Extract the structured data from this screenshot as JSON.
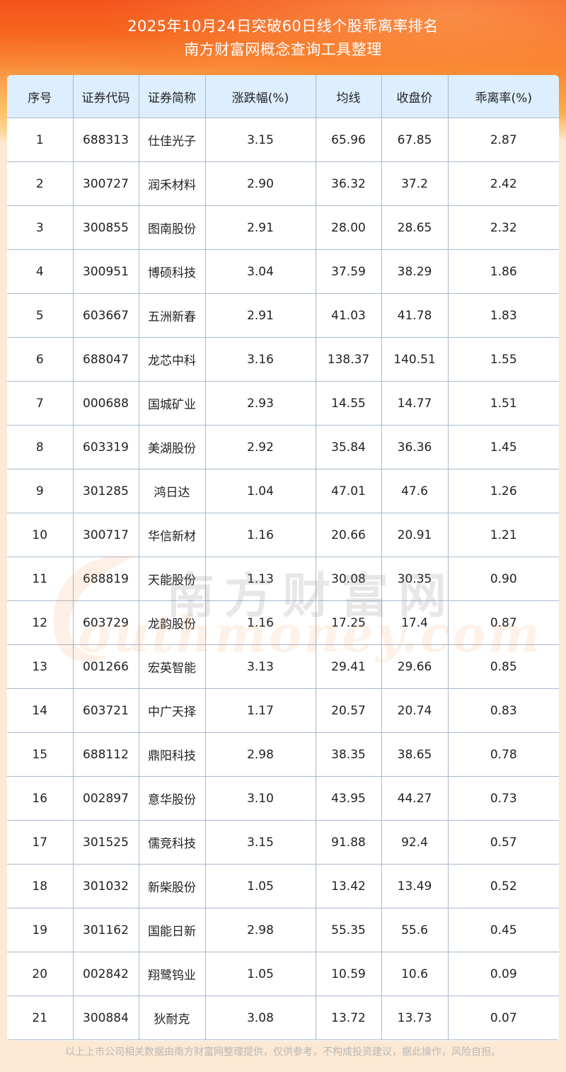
{
  "header": {
    "title_line1": "2025年10月24日突破60日线个股乖离率排名",
    "title_line2": "南方财富网概念查询工具整理"
  },
  "table": {
    "columns": [
      "序号",
      "证券代码",
      "证券简称",
      "涨跌幅(%)",
      "均线",
      "收盘价",
      "乖离率(%)"
    ],
    "rows": [
      [
        "1",
        "688313",
        "仕佳光子",
        "3.15",
        "65.96",
        "67.85",
        "2.87"
      ],
      [
        "2",
        "300727",
        "润禾材料",
        "2.90",
        "36.32",
        "37.2",
        "2.42"
      ],
      [
        "3",
        "300855",
        "图南股份",
        "2.91",
        "28.00",
        "28.65",
        "2.32"
      ],
      [
        "4",
        "300951",
        "博硕科技",
        "3.04",
        "37.59",
        "38.29",
        "1.86"
      ],
      [
        "5",
        "603667",
        "五洲新春",
        "2.91",
        "41.03",
        "41.78",
        "1.83"
      ],
      [
        "6",
        "688047",
        "龙芯中科",
        "3.16",
        "138.37",
        "140.51",
        "1.55"
      ],
      [
        "7",
        "000688",
        "国城矿业",
        "2.93",
        "14.55",
        "14.77",
        "1.51"
      ],
      [
        "8",
        "603319",
        "美湖股份",
        "2.92",
        "35.84",
        "36.36",
        "1.45"
      ],
      [
        "9",
        "301285",
        "鸿日达",
        "1.04",
        "47.01",
        "47.6",
        "1.26"
      ],
      [
        "10",
        "300717",
        "华信新材",
        "1.16",
        "20.66",
        "20.91",
        "1.21"
      ],
      [
        "11",
        "688819",
        "天能股份",
        "1.13",
        "30.08",
        "30.35",
        "0.90"
      ],
      [
        "12",
        "603729",
        "龙韵股份",
        "1.16",
        "17.25",
        "17.4",
        "0.87"
      ],
      [
        "13",
        "001266",
        "宏英智能",
        "3.13",
        "29.41",
        "29.66",
        "0.85"
      ],
      [
        "14",
        "603721",
        "中广天择",
        "1.17",
        "20.57",
        "20.74",
        "0.83"
      ],
      [
        "15",
        "688112",
        "鼎阳科技",
        "2.98",
        "38.35",
        "38.65",
        "0.78"
      ],
      [
        "16",
        "002897",
        "意华股份",
        "3.10",
        "43.95",
        "44.27",
        "0.73"
      ],
      [
        "17",
        "301525",
        "儒竞科技",
        "3.15",
        "91.88",
        "92.4",
        "0.57"
      ],
      [
        "18",
        "301032",
        "新柴股份",
        "1.05",
        "13.42",
        "13.49",
        "0.52"
      ],
      [
        "19",
        "301162",
        "国能日新",
        "2.98",
        "55.35",
        "55.6",
        "0.45"
      ],
      [
        "20",
        "002842",
        "翔鹭钨业",
        "1.05",
        "10.59",
        "10.6",
        "0.09"
      ],
      [
        "21",
        "300884",
        "狄耐克",
        "3.08",
        "13.72",
        "13.73",
        "0.07"
      ]
    ]
  },
  "watermark": {
    "cn": "南方财富网",
    "en": "outhmoney.com"
  },
  "footer": {
    "disclaimer": "以上上市公司相关数据由南方财富网整理提供，仅供参考，不构成投资建议，据此操作，风险自担。"
  },
  "colors": {
    "banner_top": "#f4541c",
    "banner_mid": "#f87420",
    "header_row_bg": "#ddeeff",
    "grid_line": "#a9b9cc",
    "page_bg": "#fde9d3"
  }
}
